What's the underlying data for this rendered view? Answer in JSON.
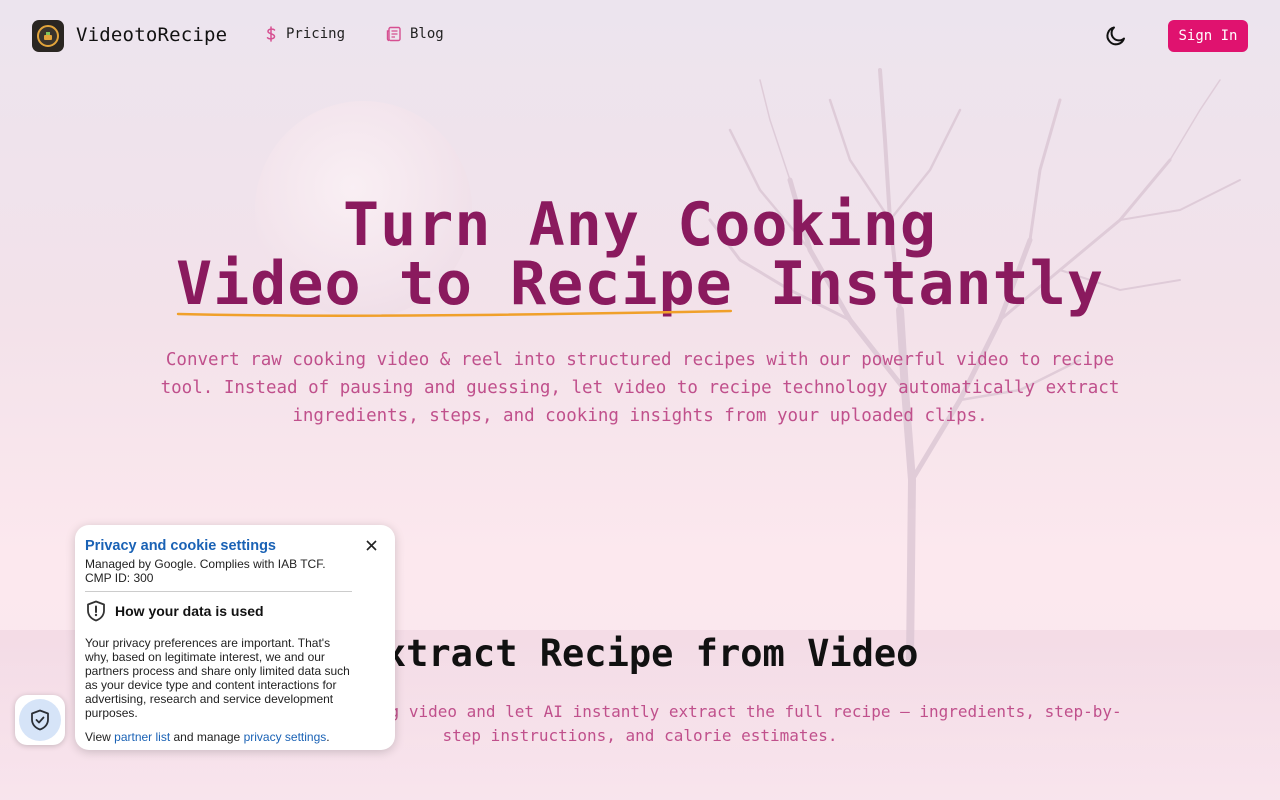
{
  "nav": {
    "brand": "VideotoRecipe",
    "links": [
      {
        "label": "Pricing",
        "icon": "dollar-icon"
      },
      {
        "label": "Blog",
        "icon": "newspaper-icon"
      }
    ],
    "theme_icon": "moon-icon",
    "signin_label": "Sign In",
    "accent": "#e0126f"
  },
  "hero": {
    "title_line1": "Turn Any Cooking",
    "title_line2_highlight": "Video to Recipe",
    "title_line2_rest": " Instantly",
    "subtitle": "Convert raw cooking video & reel into structured recipes with our powerful video to recipe tool. Instead of pausing and guessing, let video to recipe technology automatically extract ingredients, steps, and cooking insights from your uploaded clips.",
    "title_color": "#8a1a5e",
    "subtitle_color": "#c0508c"
  },
  "section": {
    "title": "Extract Recipe from Video",
    "subtitle": "Upload or paste a cooking video and let AI instantly extract the full recipe — ingredients, step-by-step instructions, and calorie estimates."
  },
  "cookie": {
    "title": "Privacy and cookie settings",
    "meta": "Managed by Google. Complies with IAB TCF. CMP ID: 300",
    "heading": "How your data is used",
    "body": "Your privacy preferences are important. That's why, based on legitimate interest, we and our partners process and share only limited data such as your device type and content interactions for advertising, research and service development purposes.",
    "foot_prefix": "View ",
    "partner_link": "partner list",
    "foot_mid": " and manage ",
    "privacy_link": "privacy settings",
    "foot_suffix": "."
  }
}
